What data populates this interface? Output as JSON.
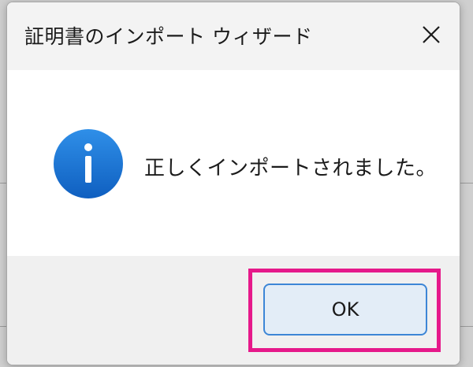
{
  "dialog": {
    "title": "証明書のインポート ウィザード",
    "close_icon": "close-icon",
    "message": "正しくインポートされました。",
    "info_icon": "info-icon",
    "ok_label": "OK"
  },
  "colors": {
    "titlebar": "#f3f3f3",
    "footer": "#f0f0f0",
    "ok_button_bg": "#e3edf7",
    "ok_button_border": "#3d86d6",
    "highlight": "#e6198a",
    "info_icon": "#1b74d4"
  }
}
